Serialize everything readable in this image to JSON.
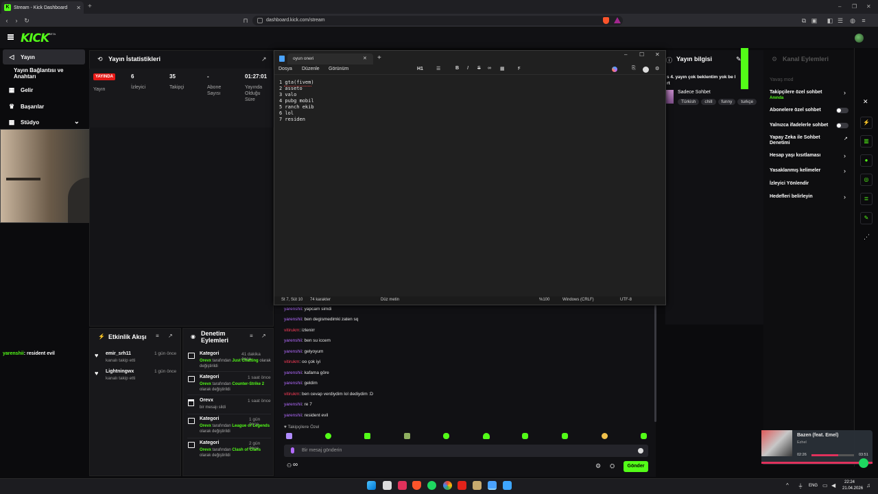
{
  "browser": {
    "tab_title": "Stream - Kick Dashboard",
    "new_tab": "+",
    "url": "dashboard.kick.com/stream",
    "window_controls": [
      "–",
      "❐",
      "✕"
    ]
  },
  "header": {
    "logo": "KICK",
    "beta": "BETA"
  },
  "sidebar": {
    "items": [
      {
        "label": "Yayın",
        "icon": "broadcast-icon"
      },
      {
        "label": "Yayın Bağlantısı ve Anahtarı",
        "icon": ""
      },
      {
        "label": "Gelir",
        "icon": "money-icon"
      },
      {
        "label": "Başarılar",
        "icon": "trophy-icon"
      },
      {
        "label": "Stüdyo",
        "icon": "studio-icon"
      }
    ],
    "studio_chevron": "⌄"
  },
  "overlay_chat": {
    "user": "yarenshii",
    "message": ": resident evil"
  },
  "stats": {
    "title": "Yayın İstatistikleri",
    "live_badge": "YAYINDA",
    "items": [
      {
        "value": "",
        "label": "Yayın"
      },
      {
        "value": "6",
        "label": "İzleyici"
      },
      {
        "value": "35",
        "label": "Takipçi"
      },
      {
        "value": "-",
        "label": "Abone Sayısı"
      },
      {
        "value": "01:27:01",
        "label": "Yayında Olduğu Süre"
      }
    ]
  },
  "activity": {
    "title": "Etkinlik Akışı",
    "items": [
      {
        "user": "emir_srh11",
        "action": "kanalı takip etti",
        "time": "1 gün önce"
      },
      {
        "user": "Lightningwx",
        "action": "kanalı takip etti",
        "time": "1 gün önce"
      }
    ]
  },
  "moderation": {
    "title": "Denetim Eylemleri",
    "items": [
      {
        "type": "Kategori",
        "by": "Orevx",
        "mid": " tarafından ",
        "target": "Just Chatting",
        "suffix": " olarak değiştirildi",
        "time": "41 dakika önce"
      },
      {
        "type": "Kategori",
        "by": "Orevx",
        "mid": " tarafından ",
        "target": "Counter-Strike 2",
        "suffix": " olarak değiştirildi",
        "time": "1 saat önce"
      },
      {
        "type": "Orevx",
        "by": "",
        "mid": "bir mesajı sildi",
        "target": "",
        "suffix": "",
        "time": "1 saat önce"
      },
      {
        "type": "Kategori",
        "by": "Orevx",
        "mid": " tarafından ",
        "target": "League of Legends",
        "suffix": " olarak değiştirildi",
        "time": "1 gün önce"
      },
      {
        "type": "Kategori",
        "by": "Orevx",
        "mid": " tarafından ",
        "target": "Clash of Clans",
        "suffix": " olarak değiştirildi",
        "time": "2 gün önce"
      }
    ]
  },
  "notepad": {
    "tab_title": "oyun oneri",
    "menu": [
      "Dosya",
      "Düzenle",
      "Görünüm"
    ],
    "heading_btn": "H1",
    "lines": [
      "1 gta(fivem)",
      "2 asseto",
      "3 valo",
      "4 pubg mobil",
      "5 ranch ekib",
      "6 lol",
      "7 residen"
    ],
    "status": {
      "position": "St 7, Süt 10",
      "chars": "74 karakter",
      "format": "Düz metin",
      "zoom": "%100",
      "line_ending": "Windows (CRLF)",
      "encoding": "UTF-8"
    }
  },
  "chat": {
    "messages": [
      {
        "user": "yarenshii",
        "color": "purple",
        "text": ": yapcam simdi"
      },
      {
        "user": "yarenshii",
        "color": "purple",
        "text": ": ben degismedimki zaten sq"
      },
      {
        "user": "vitirukm",
        "color": "red",
        "text": ": izlenirr"
      },
      {
        "user": "yarenshii",
        "color": "purple",
        "text": ": ben su iccem"
      },
      {
        "user": "yarenshii",
        "color": "purple",
        "text": ": gelyoyum"
      },
      {
        "user": "vitirukm",
        "color": "red",
        "text": ": oo çok iyi"
      },
      {
        "user": "yarenshii",
        "color": "purple",
        "text": ": kafama göre"
      },
      {
        "user": "yarenshii",
        "color": "purple",
        "text": ": geldim"
      },
      {
        "user": "vitirukm",
        "color": "red",
        "text": ": ben cevap verdiydim lol dediydim :D"
      },
      {
        "user": "yarenshii",
        "color": "purple",
        "text": ": re 7"
      },
      {
        "user": "yarenshii",
        "color": "purple",
        "text": ": resident evil"
      }
    ],
    "mode_label": "Takipçilere Özel",
    "input_placeholder": "Bir mesaj gönderin",
    "send_label": "Gönder",
    "infinity": "∞"
  },
  "stream_info": {
    "title": "Yayın bilgisi",
    "title_snippet": "s 4. yayın çok beklentim yok be l",
    "title_snippet2": "rt",
    "category": "Sadece Sohbet",
    "tags": [
      "Türkish",
      "chill",
      "funny",
      "turkçe"
    ]
  },
  "channel_actions": {
    "title": "Kanal Eylemleri",
    "slow_mode": "Yavaş mod",
    "items": [
      {
        "label": "Takipçilere özel sohbet",
        "sub": "Anında",
        "control": "chevron"
      },
      {
        "label": "Abonelere özel sohbet",
        "sub": "",
        "control": "toggle"
      },
      {
        "label": "Yalnızca ifadelerle sohbet",
        "sub": "",
        "control": "toggle"
      },
      {
        "label": "Yapay Zeka ile Sohbet Denetimi",
        "sub": "",
        "control": "external"
      },
      {
        "label": "Hesap yaşı kısıtlaması",
        "sub": "",
        "control": "chevron"
      },
      {
        "label": "Yasaklanmış kelimeler",
        "sub": "",
        "control": "chevron"
      },
      {
        "label": "İzleyici Yönlendir",
        "sub": "",
        "control": "none"
      },
      {
        "label": "Hedefleri belirleyin",
        "sub": "",
        "control": "chevron"
      }
    ]
  },
  "spotify": {
    "song": "Bazen (feat. Emel)",
    "artist": "Ezhel",
    "elapsed": "02:26",
    "duration": "03:51",
    "progress": 0.63
  },
  "taskbar": {
    "lang": "ENG",
    "time": "22:24",
    "date": "21.04.2026"
  },
  "colors": {
    "kick_green": "#53fc18",
    "live_red": "#e91916",
    "chat_purple": "#b36bff",
    "chat_red": "#ff3d5a"
  }
}
